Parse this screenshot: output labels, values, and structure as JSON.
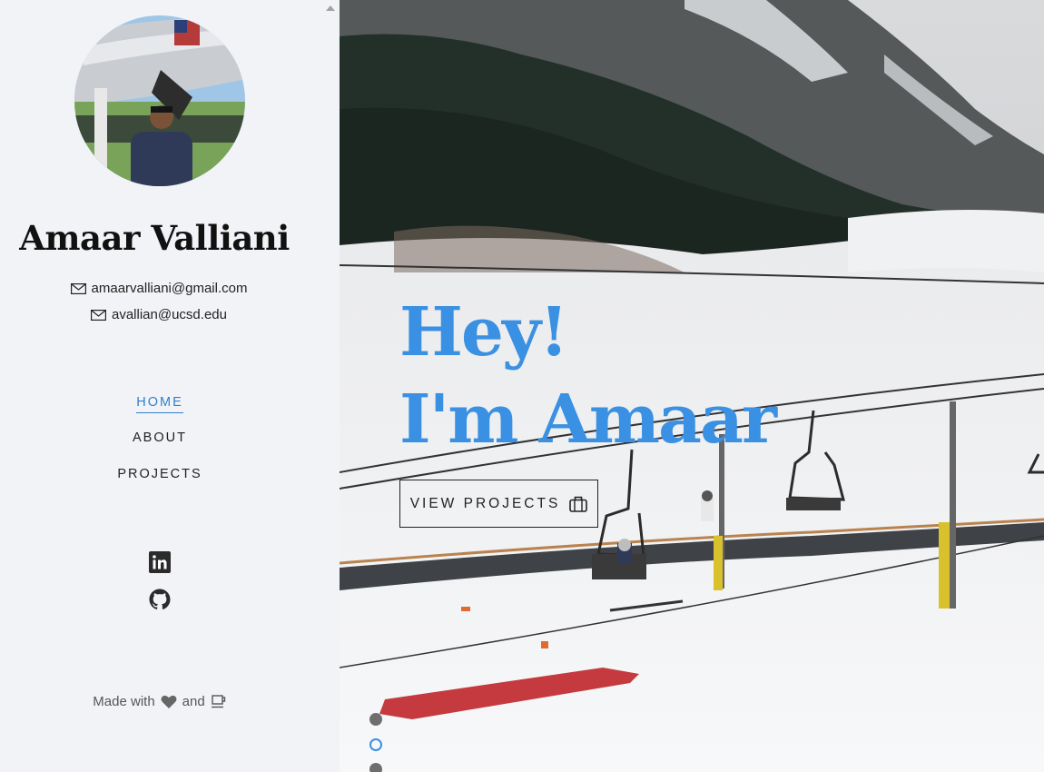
{
  "profile": {
    "name": "Amaar Valliani",
    "emails": [
      "amaarvalliani@gmail.com",
      "avallian@ucsd.edu"
    ]
  },
  "nav": {
    "items": [
      {
        "label": "HOME",
        "active": true
      },
      {
        "label": "ABOUT",
        "active": false
      },
      {
        "label": "PROJECTS",
        "active": false
      }
    ]
  },
  "social": {
    "icons": [
      "linkedin-icon",
      "github-icon"
    ]
  },
  "footer": {
    "made_with": "Made with",
    "and": "and",
    "icons": [
      "heart-icon",
      "coffee-icon"
    ]
  },
  "hero": {
    "line1": "Hey!",
    "line2": "I'm Amaar",
    "cta_label": "VIEW PROJECTS",
    "cta_icon": "briefcase-icon",
    "slides": 3,
    "active_slide": 2
  },
  "colors": {
    "accent": "#3a90e2",
    "sidebar_bg": "#f2f3f7"
  }
}
